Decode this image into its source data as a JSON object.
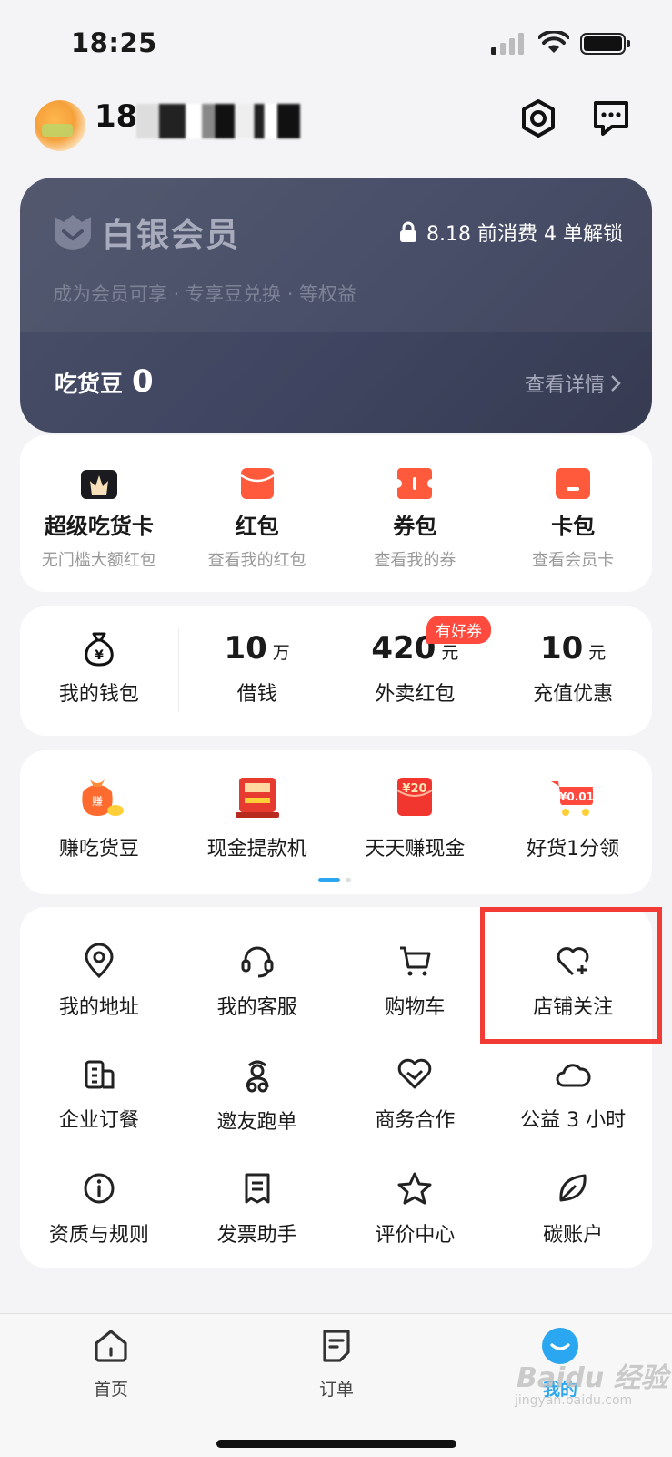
{
  "status_bar": {
    "time": "18:25"
  },
  "header": {
    "username": "18",
    "icons": [
      "settings-hexagon-icon",
      "message-icon"
    ]
  },
  "member_card": {
    "title": "白银会员",
    "unlock_text": "8.18 前消费 4 单解锁",
    "subtitle": "成为会员可享 · 专享豆兑换 · 等权益",
    "beans_label": "吃货豆",
    "beans_value": "0",
    "details_label": "查看详情"
  },
  "wallet_row": [
    {
      "title": "超级吃货卡",
      "sub": "无门槛大额红包",
      "icon": "crown-card-icon"
    },
    {
      "title": "红包",
      "sub": "查看我的红包",
      "icon": "red-packet-icon"
    },
    {
      "title": "券包",
      "sub": "查看我的券",
      "icon": "coupon-icon"
    },
    {
      "title": "卡包",
      "sub": "查看会员卡",
      "icon": "card-icon"
    }
  ],
  "finance_row": {
    "wallet_label": "我的钱包",
    "items": [
      {
        "value": "10",
        "unit": "万",
        "label": "借钱"
      },
      {
        "value": "420",
        "unit": "元",
        "label": "外卖红包",
        "badge": "有好券"
      },
      {
        "value": "10",
        "unit": "元",
        "label": "充值优惠"
      }
    ]
  },
  "activities": [
    {
      "label": "赚吃货豆",
      "icon": "money-bag-icon"
    },
    {
      "label": "现金提款机",
      "icon": "atm-icon"
    },
    {
      "label": "天天赚现金",
      "icon": "cash-envelope-icon"
    },
    {
      "label": "好货1分领",
      "icon": "shopping-cart-promo-icon"
    }
  ],
  "services": [
    {
      "label": "我的地址",
      "icon": "location-icon"
    },
    {
      "label": "我的客服",
      "icon": "headset-icon"
    },
    {
      "label": "购物车",
      "icon": "cart-icon"
    },
    {
      "label": "店铺关注",
      "icon": "heart-plus-icon"
    },
    {
      "label": "企业订餐",
      "icon": "building-icon"
    },
    {
      "label": "邀友跑单",
      "icon": "rider-icon"
    },
    {
      "label": "商务合作",
      "icon": "handshake-icon"
    },
    {
      "label": "公益 3 小时",
      "icon": "cloud-heart-icon"
    },
    {
      "label": "资质与规则",
      "icon": "info-icon"
    },
    {
      "label": "发票助手",
      "icon": "receipt-icon"
    },
    {
      "label": "评价中心",
      "icon": "star-icon"
    },
    {
      "label": "碳账户",
      "icon": "leaf-icon"
    }
  ],
  "tabbar": [
    {
      "label": "首页",
      "icon": "home-icon"
    },
    {
      "label": "订单",
      "icon": "order-icon"
    },
    {
      "label": "我的",
      "icon": "profile-icon",
      "active": true
    }
  ],
  "watermark": {
    "brand": "Baidu 经验",
    "url": "jingyan.baidu.com"
  },
  "colors": {
    "accent": "#2aa7f0",
    "badge_red": "#ff4a3d",
    "highlight": "#f33b35",
    "card_dark": "#3f4560"
  }
}
